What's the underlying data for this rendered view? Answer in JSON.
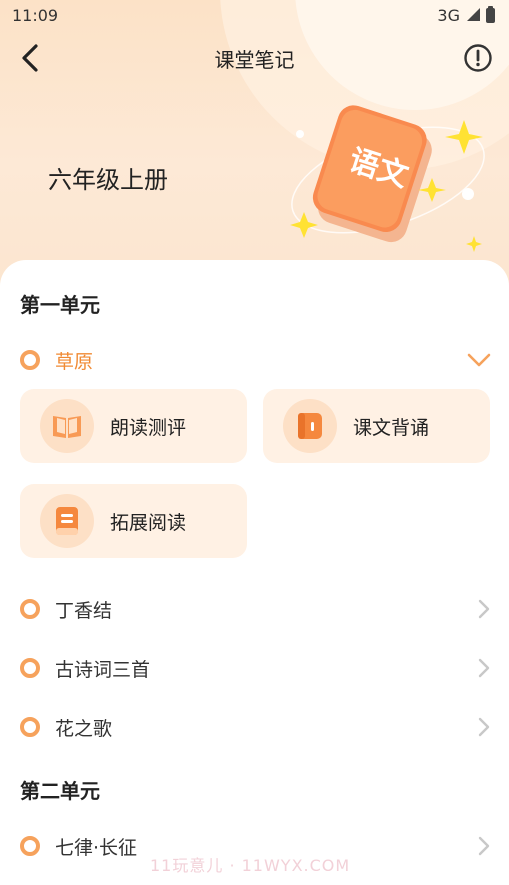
{
  "status_bar": {
    "time": "11:09",
    "network": "3G"
  },
  "header": {
    "title": "课堂笔记"
  },
  "hero": {
    "grade": "六年级上册",
    "book_label": "语文"
  },
  "units": [
    {
      "title": "第一单元",
      "lessons": [
        {
          "label": "草原",
          "expanded": true
        },
        {
          "label": "丁香结"
        },
        {
          "label": "古诗词三首"
        },
        {
          "label": "花之歌"
        }
      ],
      "tiles": [
        {
          "label": "朗读测评",
          "icon": "open-book-icon"
        },
        {
          "label": "课文背诵",
          "icon": "closed-book-icon"
        },
        {
          "label": "拓展阅读",
          "icon": "document-icon"
        }
      ]
    },
    {
      "title": "第二单元",
      "lessons": [
        {
          "label": "七律·长征"
        }
      ]
    }
  ],
  "watermark": "11玩意儿 · 11WYX.COM",
  "colors": {
    "accent": "#f08a33",
    "dot": "#f6a25c",
    "tile_bg": "#fff1e4",
    "hero_bg": "#fce2c7"
  }
}
